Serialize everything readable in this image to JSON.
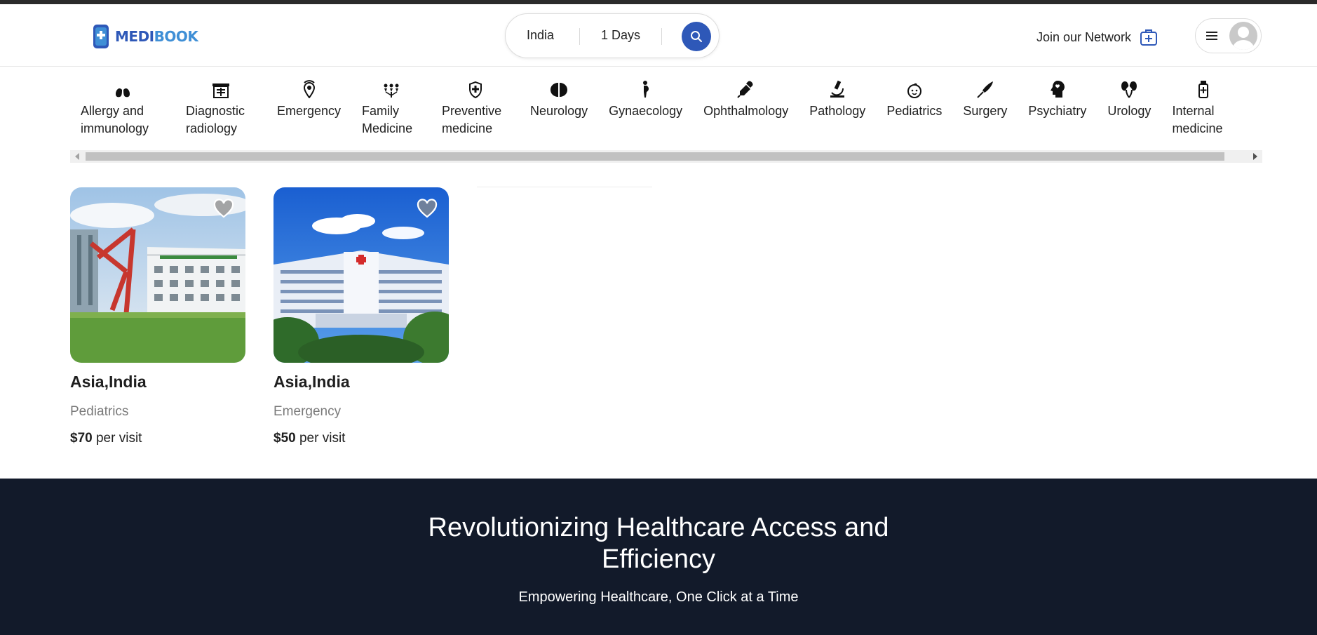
{
  "header": {
    "logo_text": "MEDIBOOK",
    "logo_part_a": "MEDI",
    "logo_part_b": "BOOK",
    "search": {
      "location": "India",
      "duration": "1 Days"
    },
    "join_label": "Join our Network"
  },
  "categories": [
    {
      "label": "Allergy and immunology",
      "icon": "lungs-icon"
    },
    {
      "label": "Diagnostic radiology",
      "icon": "xray-icon"
    },
    {
      "label": "Emergency",
      "icon": "emergency-icon"
    },
    {
      "label": "Family Medicine",
      "icon": "family-icon"
    },
    {
      "label": "Preventive medicine",
      "icon": "shield-icon"
    },
    {
      "label": "Neurology",
      "icon": "brain-icon"
    },
    {
      "label": "Gynaecology",
      "icon": "pregnant-icon"
    },
    {
      "label": "Ophthalmology",
      "icon": "dropper-icon"
    },
    {
      "label": "Pathology",
      "icon": "microscope-icon"
    },
    {
      "label": "Pediatrics",
      "icon": "baby-icon"
    },
    {
      "label": "Surgery",
      "icon": "scalpel-icon"
    },
    {
      "label": "Psychiatry",
      "icon": "head-icon"
    },
    {
      "label": "Urology",
      "icon": "kidney-icon"
    },
    {
      "label": "Internal medicine",
      "icon": "bottle-icon"
    }
  ],
  "cards": [
    {
      "location": "Asia,India",
      "specialty": "Pediatrics",
      "price": "$70",
      "price_suffix": "per visit"
    },
    {
      "location": "Asia,India",
      "specialty": "Emergency",
      "price": "$50",
      "price_suffix": "per visit"
    }
  ],
  "footer": {
    "headline": "Revolutionizing Healthcare Access and Efficiency",
    "subline": "Empowering Healthcare, One Click at a Time"
  },
  "colors": {
    "brand": "#2e58b8",
    "footer_bg": "#121a2a"
  }
}
